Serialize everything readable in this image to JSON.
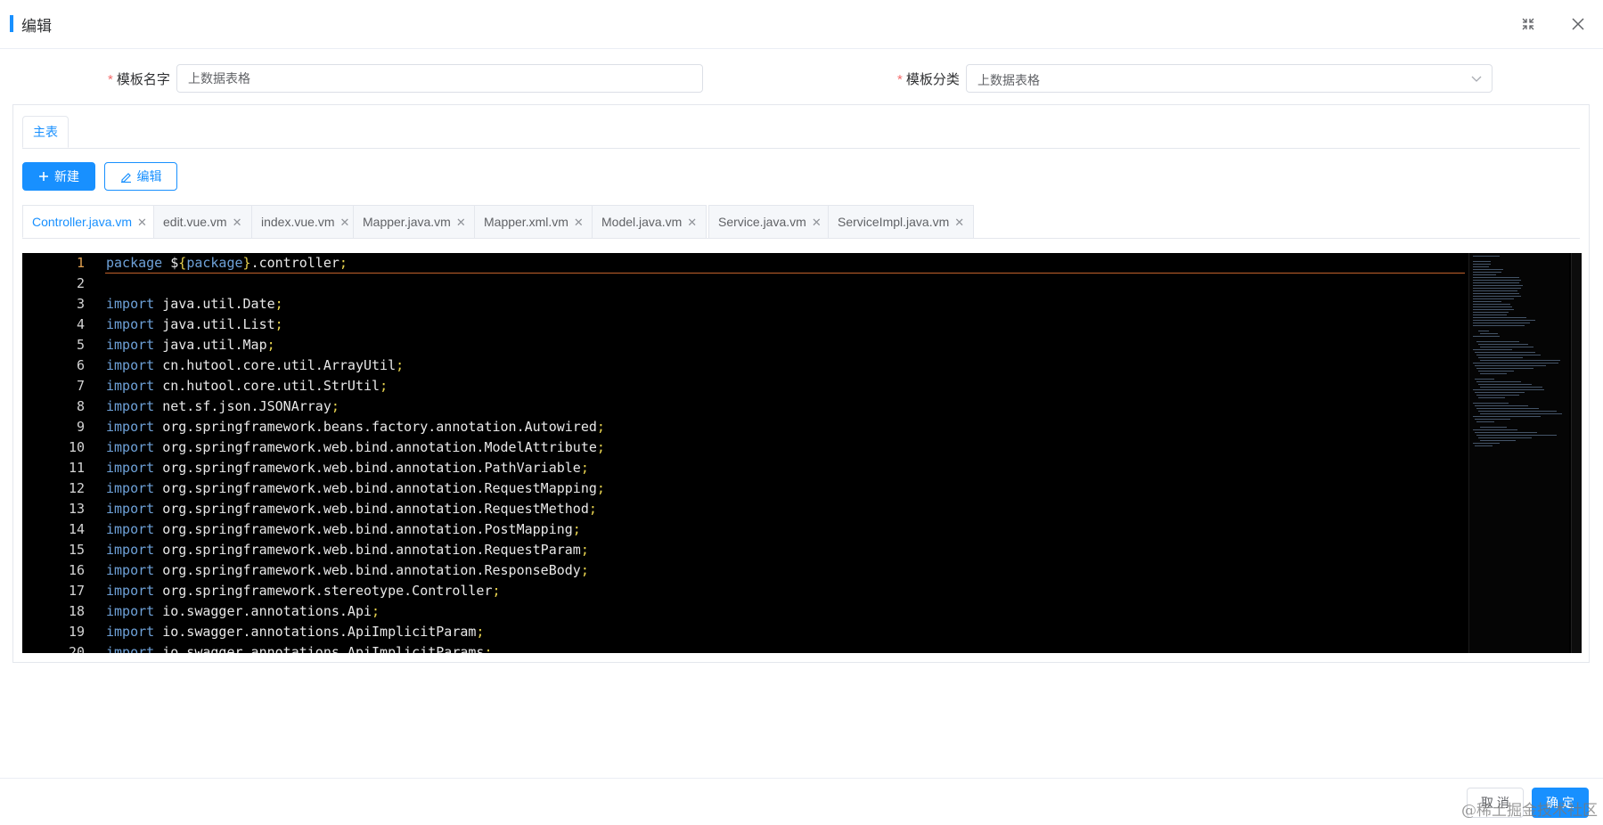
{
  "dialog": {
    "title": "编辑",
    "fullscreen_icon": "fullscreen-exit-icon",
    "close_icon": "close-icon"
  },
  "form": {
    "name_label": "模板名字",
    "name_value": "上数据表格",
    "category_label": "模板分类",
    "category_value": "上数据表格"
  },
  "main_tabs": [
    {
      "label": "主表"
    }
  ],
  "toolbar": {
    "new_label": "新建",
    "edit_label": "编辑"
  },
  "file_tabs": [
    {
      "label": "Controller.java.vm",
      "active": true
    },
    {
      "label": "edit.vue.vm"
    },
    {
      "label": "index.vue.vm"
    },
    {
      "label": "Mapper.java.vm"
    },
    {
      "label": "Mapper.xml.vm"
    },
    {
      "label": "Model.java.vm"
    },
    {
      "label": "Service.java.vm"
    },
    {
      "label": "ServiceImpl.java.vm"
    }
  ],
  "code_lines": [
    "package ${package}.controller;",
    "",
    "import java.util.Date;",
    "import java.util.List;",
    "import java.util.Map;",
    "import cn.hutool.core.util.ArrayUtil;",
    "import cn.hutool.core.util.StrUtil;",
    "import net.sf.json.JSONArray;",
    "import org.springframework.beans.factory.annotation.Autowired;",
    "import org.springframework.web.bind.annotation.ModelAttribute;",
    "import org.springframework.web.bind.annotation.PathVariable;",
    "import org.springframework.web.bind.annotation.RequestMapping;",
    "import org.springframework.web.bind.annotation.RequestMethod;",
    "import org.springframework.web.bind.annotation.PostMapping;",
    "import org.springframework.web.bind.annotation.RequestParam;",
    "import org.springframework.web.bind.annotation.ResponseBody;",
    "import org.springframework.stereotype.Controller;",
    "import io.swagger.annotations.Api;",
    "import io.swagger.annotations.ApiImplicitParam;",
    "import io.swagger.annotations.ApiImplicitParams;"
  ],
  "footer": {
    "cancel_label": "取 消",
    "ok_label": "确 定"
  },
  "watermark": "@稀土掘金技术社区",
  "colors": {
    "accent": "#1890ff",
    "required": "#f56c6c",
    "editor_bg": "#000000",
    "keyword": "#6ea1d8",
    "punct": "#e8d34f"
  }
}
